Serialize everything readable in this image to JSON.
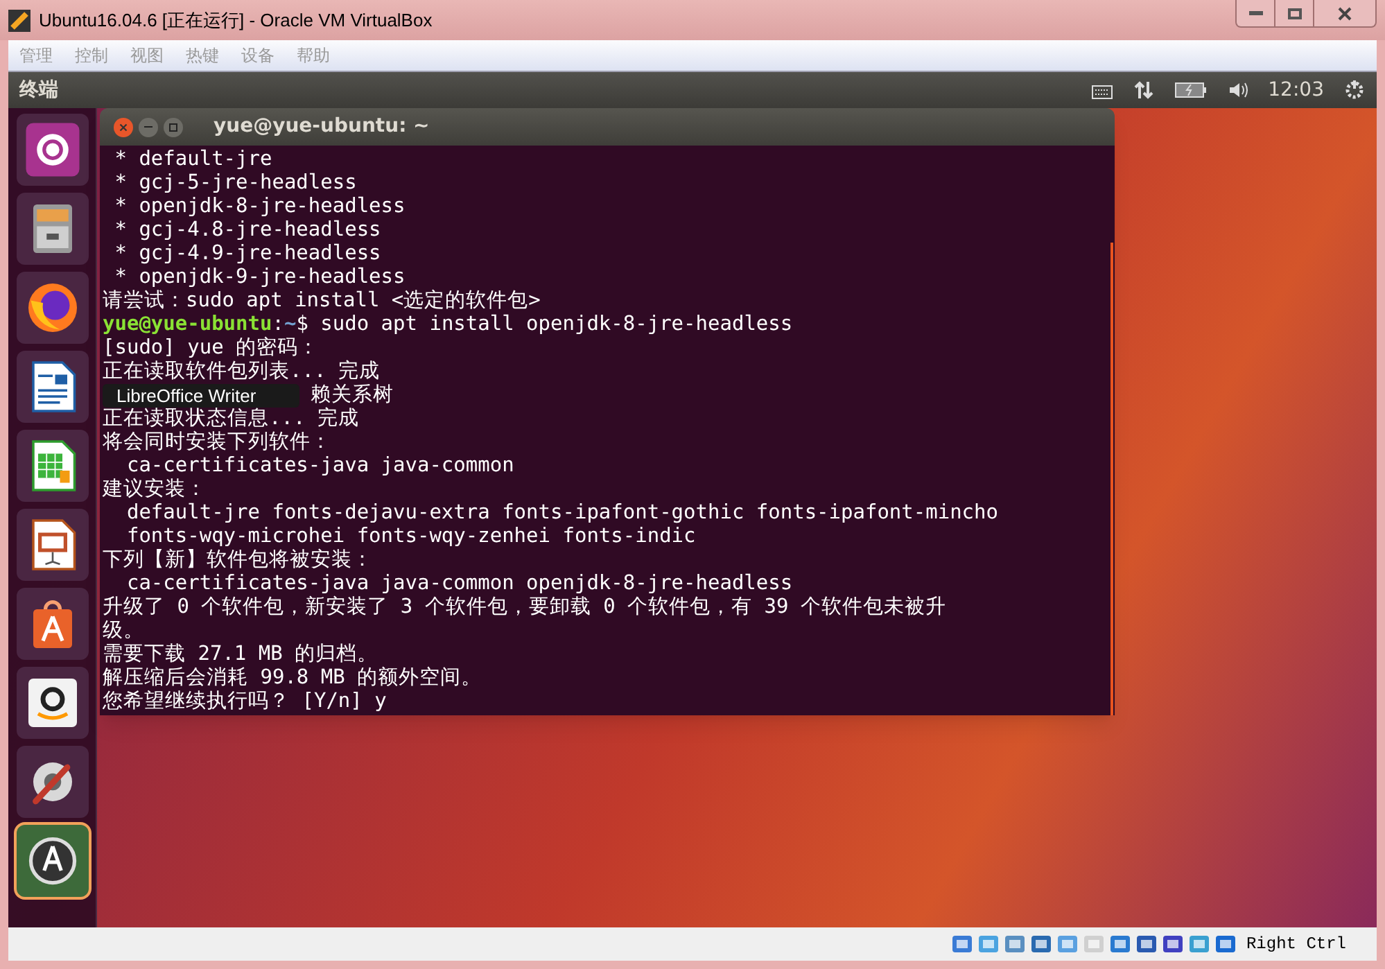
{
  "window": {
    "title": "Ubuntu16.04.6 [正在运行] - Oracle VM VirtualBox"
  },
  "menu": [
    "管理",
    "控制",
    "视图",
    "热键",
    "设备",
    "帮助"
  ],
  "top_panel": {
    "app_title": "终端",
    "clock": "12:03"
  },
  "launcher": [
    {
      "kind": "ubuntu",
      "running": false
    },
    {
      "kind": "files",
      "running": false
    },
    {
      "kind": "firefox",
      "running": false
    },
    {
      "kind": "writer",
      "running": false
    },
    {
      "kind": "calc",
      "running": false
    },
    {
      "kind": "impress",
      "running": false
    },
    {
      "kind": "store",
      "running": false
    },
    {
      "kind": "amazon",
      "running": false
    },
    {
      "kind": "settings",
      "running": false
    },
    {
      "kind": "updater",
      "running": true
    }
  ],
  "tooltip": "LibreOffice Writer",
  "terminal": {
    "title": "yue@yue-ubuntu: ~",
    "lines": [
      {
        "kind": "text",
        "text": " * default-jre"
      },
      {
        "kind": "text",
        "text": " * gcj-5-jre-headless"
      },
      {
        "kind": "text",
        "text": " * openjdk-8-jre-headless"
      },
      {
        "kind": "text",
        "text": " * gcj-4.8-jre-headless"
      },
      {
        "kind": "text",
        "text": " * gcj-4.9-jre-headless"
      },
      {
        "kind": "text",
        "text": " * openjdk-9-jre-headless"
      },
      {
        "kind": "text",
        "text": "请尝试：sudo apt install <选定的软件包>"
      },
      {
        "kind": "prompt",
        "user_host": "yue@yue-ubuntu",
        "separator": ":",
        "path": "~",
        "command": "$ sudo apt install openjdk-8-jre-headless"
      },
      {
        "kind": "text",
        "text": "[sudo] yue 的密码："
      },
      {
        "kind": "text",
        "text": "正在读取软件包列表... 完成"
      },
      {
        "kind": "covered",
        "text": "赖关系树"
      },
      {
        "kind": "text",
        "text": "正在读取状态信息... 完成"
      },
      {
        "kind": "text",
        "text": "将会同时安装下列软件："
      },
      {
        "kind": "text",
        "text": "  ca-certificates-java java-common"
      },
      {
        "kind": "text",
        "text": "建议安装："
      },
      {
        "kind": "text",
        "text": "  default-jre fonts-dejavu-extra fonts-ipafont-gothic fonts-ipafont-mincho"
      },
      {
        "kind": "text",
        "text": "  fonts-wqy-microhei fonts-wqy-zenhei fonts-indic"
      },
      {
        "kind": "text",
        "text": "下列【新】软件包将被安装："
      },
      {
        "kind": "text",
        "text": "  ca-certificates-java java-common openjdk-8-jre-headless"
      },
      {
        "kind": "text",
        "text": "升级了 0 个软件包，新安装了 3 个软件包，要卸载 0 个软件包，有 39 个软件包未被升"
      },
      {
        "kind": "text",
        "text": "级。"
      },
      {
        "kind": "text",
        "text": "需要下载 27.1 MB 的归档。"
      },
      {
        "kind": "text",
        "text": "解压缩后会消耗 99.8 MB 的额外空间。"
      },
      {
        "kind": "text",
        "text": "您希望继续执行吗？ [Y/n] y"
      }
    ]
  },
  "status_bar": {
    "host_key": "Right Ctrl"
  }
}
